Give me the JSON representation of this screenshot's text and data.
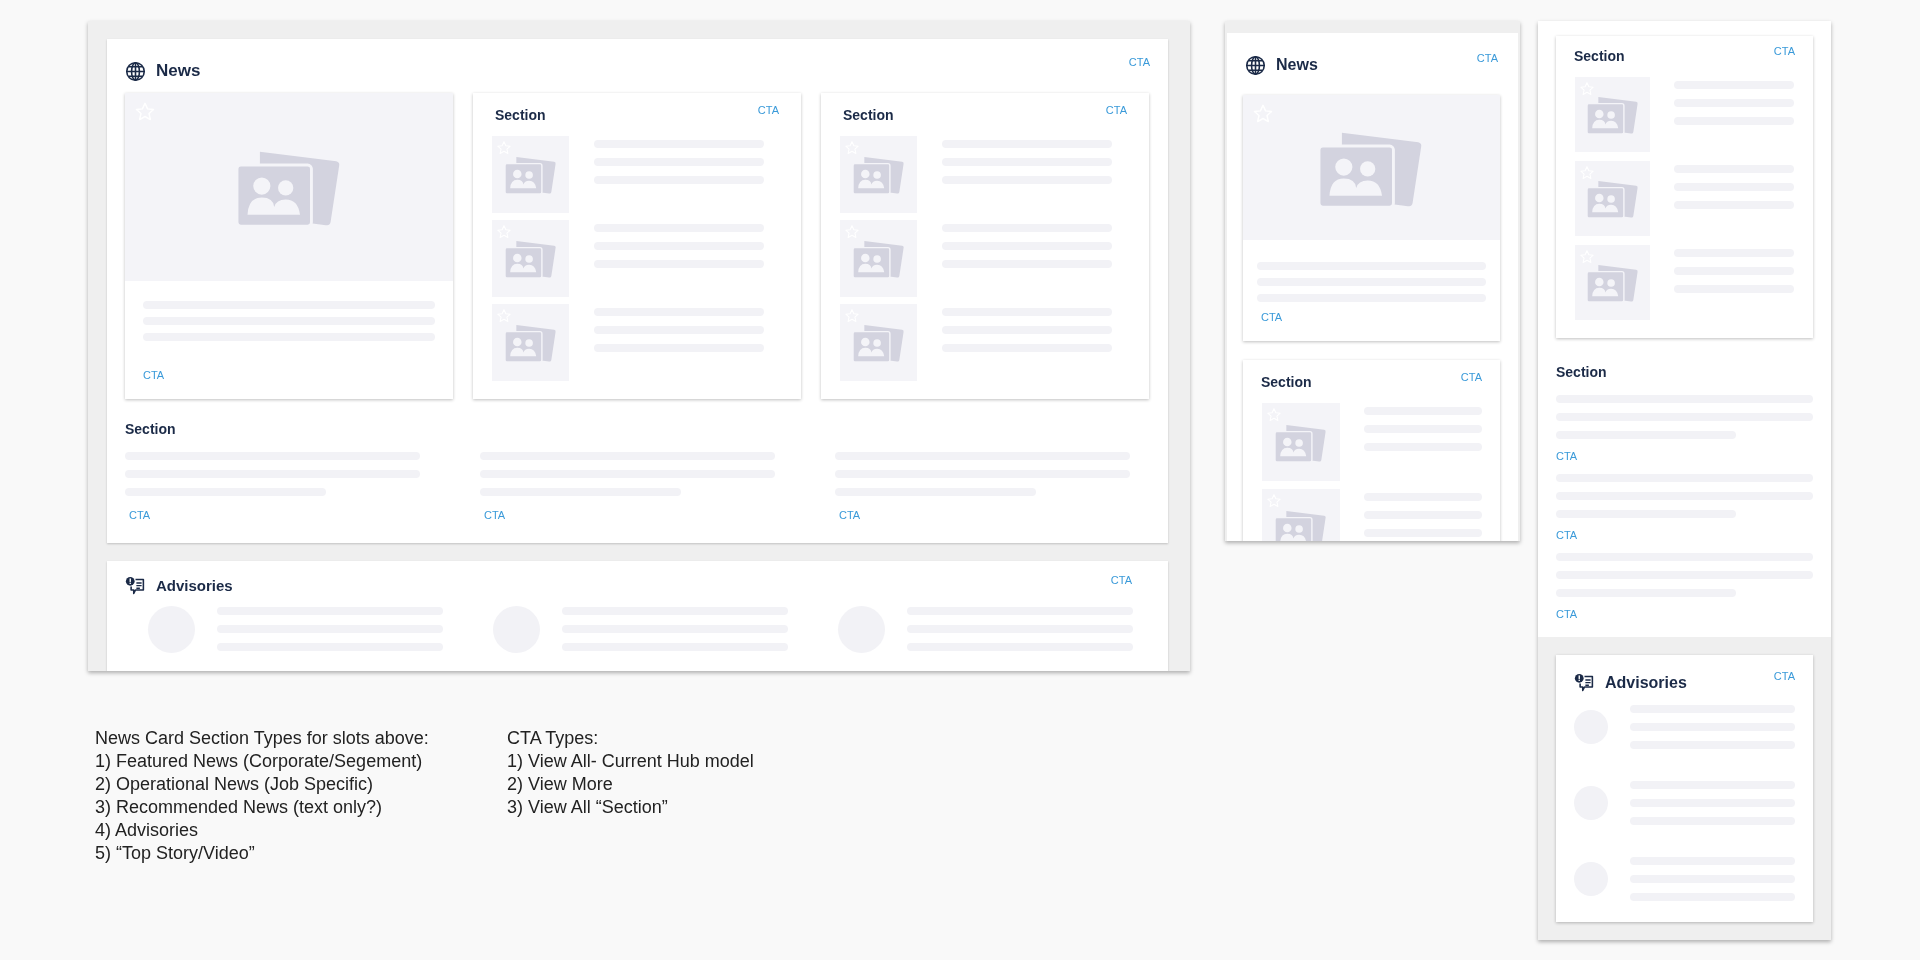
{
  "wide_layout": {
    "news": {
      "title": "News",
      "cta": "CTA",
      "featured": {
        "cta": "CTA"
      },
      "section_cards": [
        {
          "title": "Section",
          "cta": "CTA"
        },
        {
          "title": "Section",
          "cta": "CTA"
        }
      ],
      "text_section": {
        "title": "Section",
        "ctas": [
          "CTA",
          "CTA",
          "CTA"
        ]
      }
    },
    "advisories": {
      "title": "Advisories",
      "cta": "CTA"
    }
  },
  "medium_layout": {
    "news": {
      "title": "News",
      "cta": "CTA",
      "featured": {
        "cta": "CTA"
      }
    },
    "section_card": {
      "title": "Section",
      "cta": "CTA"
    }
  },
  "narrow_layout": {
    "section_card": {
      "title": "Section",
      "cta": "CTA"
    },
    "text_section": {
      "title": "Section",
      "ctas": [
        "CTA",
        "CTA",
        "CTA"
      ]
    },
    "advisories": {
      "title": "Advisories",
      "cta": "CTA"
    }
  },
  "notes": [
    {
      "title": "News Card Section Types for slots above:",
      "items": [
        "1) Featured News (Corporate/Segement)",
        "2) Operational News (Job Specific)",
        "3) Recommended News (text only?)",
        "4) Advisories",
        "5) “Top Story/Video”"
      ]
    },
    {
      "title": "CTA Types:",
      "items": [
        "1) View All- Current Hub model",
        "2) View More",
        "3) View All “Section”"
      ]
    }
  ]
}
